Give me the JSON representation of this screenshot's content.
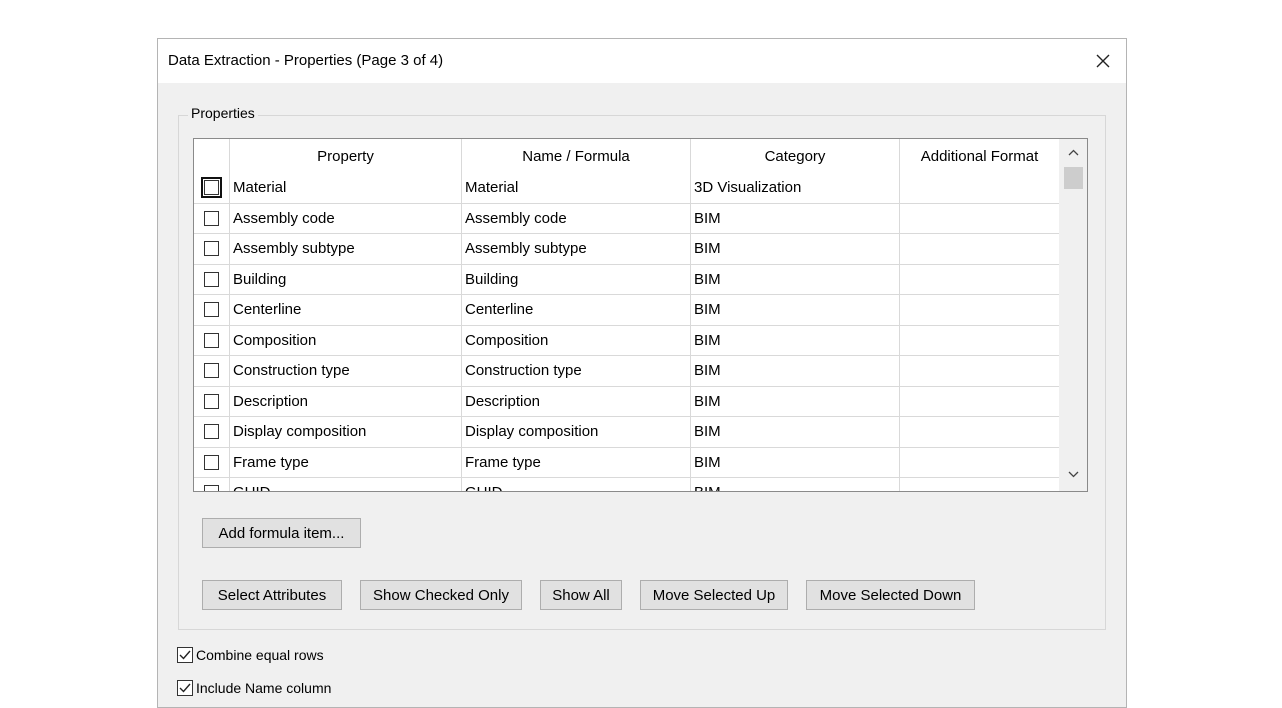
{
  "dialog": {
    "title": "Data Extraction - Properties (Page 3 of 4)"
  },
  "properties_group": {
    "label": "Properties",
    "columns": [
      "",
      "Property",
      "Name / Formula",
      "Category",
      "Additional Format"
    ],
    "rows": [
      {
        "checked": false,
        "property": "Material",
        "name_formula": "Material",
        "category": "3D Visualization",
        "additional_format": ""
      },
      {
        "checked": false,
        "property": "Assembly code",
        "name_formula": "Assembly code",
        "category": "BIM",
        "additional_format": ""
      },
      {
        "checked": false,
        "property": "Assembly subtype",
        "name_formula": "Assembly subtype",
        "category": "BIM",
        "additional_format": ""
      },
      {
        "checked": false,
        "property": "Building",
        "name_formula": "Building",
        "category": "BIM",
        "additional_format": ""
      },
      {
        "checked": false,
        "property": "Centerline",
        "name_formula": "Centerline",
        "category": "BIM",
        "additional_format": ""
      },
      {
        "checked": false,
        "property": "Composition",
        "name_formula": "Composition",
        "category": "BIM",
        "additional_format": ""
      },
      {
        "checked": false,
        "property": "Construction type",
        "name_formula": "Construction type",
        "category": "BIM",
        "additional_format": ""
      },
      {
        "checked": false,
        "property": "Description",
        "name_formula": "Description",
        "category": "BIM",
        "additional_format": ""
      },
      {
        "checked": false,
        "property": "Display composition",
        "name_formula": "Display composition",
        "category": "BIM",
        "additional_format": ""
      },
      {
        "checked": false,
        "property": "Frame type",
        "name_formula": "Frame type",
        "category": "BIM",
        "additional_format": ""
      },
      {
        "checked": false,
        "property": "GUID",
        "name_formula": "GUID",
        "category": "BIM",
        "additional_format": ""
      }
    ],
    "add_formula_label": "Add formula item...",
    "buttons": {
      "select_attributes": "Select Attributes",
      "show_checked_only": "Show Checked Only",
      "show_all": "Show All",
      "move_up": "Move Selected Up",
      "move_down": "Move Selected Down"
    }
  },
  "options": {
    "combine_equal_rows": {
      "label": "Combine equal rows",
      "checked": true
    },
    "include_name_column": {
      "label": "Include Name column",
      "checked": true
    }
  },
  "icons": {
    "close": "close-icon",
    "scroll_up": "chevron-up-icon",
    "scroll_down": "chevron-down-icon",
    "check": "checkmark-icon"
  }
}
